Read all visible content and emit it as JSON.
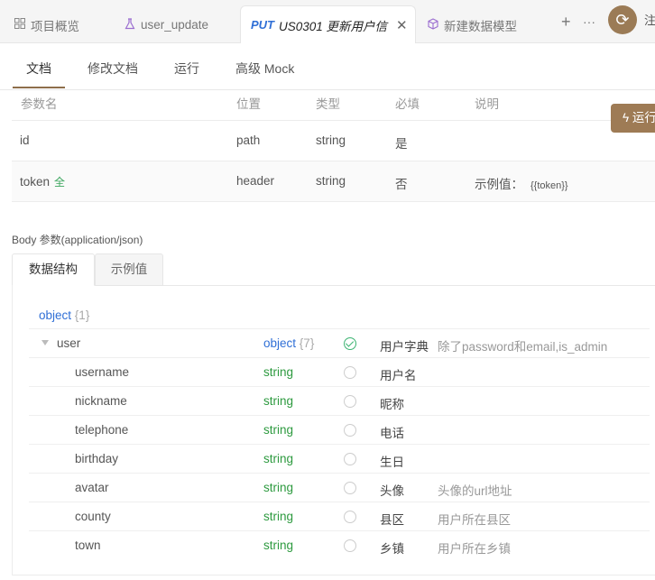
{
  "tabs": [
    {
      "label": "项目概览"
    },
    {
      "label": "user_update"
    },
    {
      "method": "PUT",
      "label": "US0301 更新用户信"
    },
    {
      "label": "新建数据模型"
    }
  ],
  "topbar": {
    "plus": "+",
    "more": "···",
    "cut_text": "注"
  },
  "subtabs": [
    "文档",
    "修改文档",
    "运行",
    "高级 Mock"
  ],
  "run_button": "运行",
  "params": {
    "headers": [
      "参数名",
      "位置",
      "类型",
      "必填",
      "说明"
    ],
    "rows": [
      {
        "name": "id",
        "badge": "",
        "in": "path",
        "type": "string",
        "required": "是",
        "desc": "",
        "example": ""
      },
      {
        "name": "token",
        "badge": "全",
        "in": "header",
        "type": "string",
        "required": "否",
        "desc": "示例值：",
        "example": "{{token}}"
      }
    ]
  },
  "body_label": "Body 参数(application/json)",
  "body_tabs": [
    "数据结构",
    "示例值"
  ],
  "schema": {
    "root_type": "object",
    "root_count": "{1}",
    "fields": [
      {
        "name": "user",
        "type": "object",
        "count": "{7}",
        "required": true,
        "title": "用户字典",
        "desc": "除了password和email,is_admin",
        "expandable": true
      },
      {
        "name": "username",
        "type": "string",
        "count": "",
        "required": false,
        "title": "用户名",
        "desc": ""
      },
      {
        "name": "nickname",
        "type": "string",
        "count": "",
        "required": false,
        "title": "昵称",
        "desc": ""
      },
      {
        "name": "telephone",
        "type": "string",
        "count": "",
        "required": false,
        "title": "电话",
        "desc": ""
      },
      {
        "name": "birthday",
        "type": "string",
        "count": "",
        "required": false,
        "title": "生日",
        "desc": ""
      },
      {
        "name": "avatar",
        "type": "string",
        "count": "",
        "required": false,
        "title": "头像",
        "desc": "头像的url地址"
      },
      {
        "name": "county",
        "type": "string",
        "count": "",
        "required": false,
        "title": "县区",
        "desc": "用户所在县区"
      },
      {
        "name": "town",
        "type": "string",
        "count": "",
        "required": false,
        "title": "乡镇",
        "desc": "用户所在乡镇"
      }
    ]
  },
  "colors": {
    "accent": "#9e7b55",
    "method": "#2f6fd6",
    "string_type": "#2d9a3f",
    "required": "#3bb371"
  }
}
